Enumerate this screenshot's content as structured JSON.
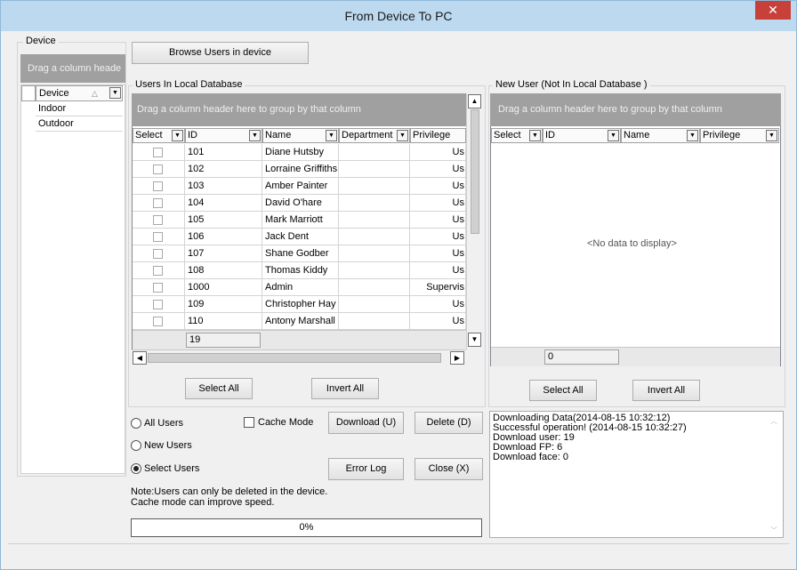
{
  "window": {
    "title": "From Device To PC",
    "close_glyph": "✕"
  },
  "device_panel": {
    "label": "Device",
    "drag_hint": "Drag a column heade",
    "column": "Device",
    "items": [
      "Indoor",
      "Outdoor"
    ]
  },
  "browse_button": "Browse Users in device",
  "local_db": {
    "label": "Users In Local Database",
    "drag_hint": "Drag a column header here to group by that column",
    "columns": [
      "Select",
      "ID",
      "Name",
      "Department",
      "Privilege"
    ],
    "rows": [
      {
        "id": "101",
        "name": "Diane Hutsby",
        "privilege": "Us"
      },
      {
        "id": "102",
        "name": "Lorraine Griffiths",
        "privilege": "Us"
      },
      {
        "id": "103",
        "name": "Amber Painter",
        "privilege": "Us"
      },
      {
        "id": "104",
        "name": "David O'hare",
        "privilege": "Us"
      },
      {
        "id": "105",
        "name": "Mark Marriott",
        "privilege": "Us"
      },
      {
        "id": "106",
        "name": "Jack Dent",
        "privilege": "Us"
      },
      {
        "id": "107",
        "name": "Shane Godber",
        "privilege": "Us"
      },
      {
        "id": "108",
        "name": "Thomas Kiddy",
        "privilege": "Us"
      },
      {
        "id": "1000",
        "name": "Admin",
        "privilege": "Supervis"
      },
      {
        "id": "109",
        "name": "Christopher Hay",
        "privilege": "Us"
      },
      {
        "id": "110",
        "name": "Antony Marshall",
        "privilege": "Us"
      }
    ],
    "count": "19",
    "select_all": "Select All",
    "invert_all": "Invert All"
  },
  "new_user": {
    "label": "New User (Not In Local Database )",
    "drag_hint": "Drag a column header here to group by that column",
    "columns": [
      "Select",
      "ID",
      "Name",
      "Privilege"
    ],
    "empty_text": "<No data to display>",
    "count": "0",
    "select_all": "Select All",
    "invert_all": "Invert All"
  },
  "options": {
    "all_users": "All Users",
    "new_users": "New Users",
    "select_users": "Select Users",
    "selected": "select_users",
    "cache_mode": "Cache Mode",
    "cache_mode_checked": false
  },
  "actions": {
    "download": "Download (U)",
    "delete": "Delete (D)",
    "error_log": "Error Log",
    "close": "Close (X)"
  },
  "notes": {
    "line1": "Note:Users can only be deleted in the device.",
    "line2": "Cache mode can improve speed."
  },
  "progress": {
    "text": "0%",
    "value": 0
  },
  "log_lines": [
    "Downloading Data(2014-08-15 10:32:12)",
    "Successful operation! (2014-08-15 10:32:27)",
    "Download user: 19",
    "Download FP: 6",
    "Download face: 0"
  ]
}
